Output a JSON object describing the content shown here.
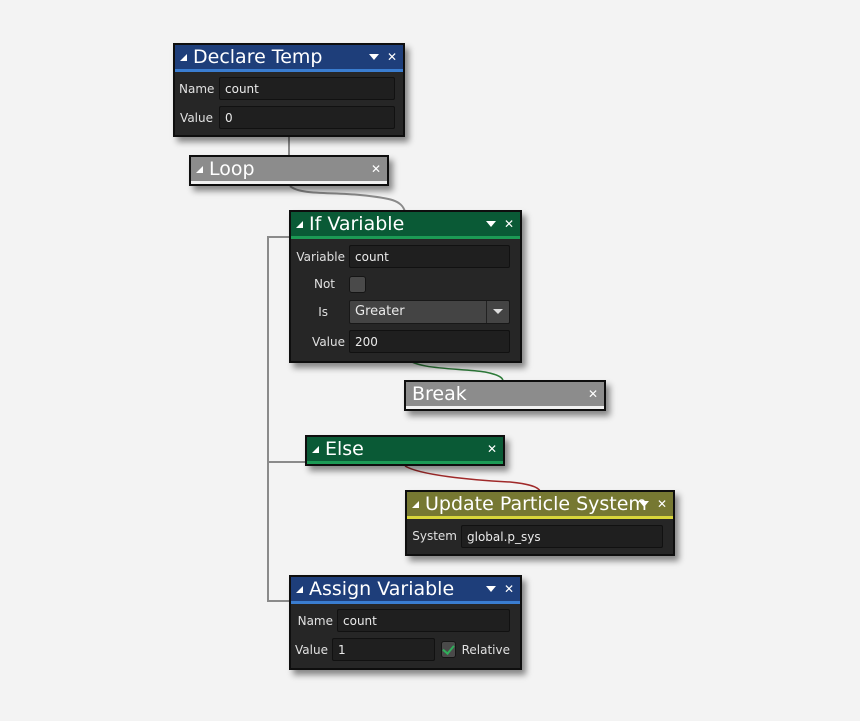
{
  "colors": {
    "canvas_bg": "#f3f3f3",
    "node_body": "#262626",
    "blue_header": "#1e3e7a",
    "blue_accent": "#3a7dd0",
    "green_header": "#0a5a36",
    "green_accent": "#1c9a55",
    "gray_header": "#8c8c8c",
    "olive_header": "#767832",
    "olive_accent": "#d8d63a",
    "wire_gray": "#888888",
    "wire_green": "#2e7d3a",
    "wire_red": "#a02a2a"
  },
  "nodes": {
    "declare_temp": {
      "title": "Declare Temp",
      "fields": [
        {
          "label": "Name",
          "value": "count"
        },
        {
          "label": "Value",
          "value": "0"
        }
      ]
    },
    "loop": {
      "title": "Loop"
    },
    "if_variable": {
      "title": "If Variable",
      "variable_label": "Variable",
      "variable_value": "count",
      "not_label": "Not",
      "not_checked": false,
      "is_label": "Is",
      "is_value": "Greater",
      "value_label": "Value",
      "value_value": "200"
    },
    "break": {
      "title": "Break"
    },
    "else": {
      "title": "Else"
    },
    "update_particle_system": {
      "title": "Update Particle System",
      "system_label": "System",
      "system_value": "global.p_sys"
    },
    "assign_variable": {
      "title": "Assign Variable",
      "name_label": "Name",
      "name_value": "count",
      "value_label": "Value",
      "value_value": "1",
      "relative_label": "Relative",
      "relative_checked": true
    }
  },
  "icons": {
    "collapse": "collapse-triangle-icon",
    "dropdown": "dropdown-arrow-icon",
    "close": "close-icon",
    "check": "check-icon"
  }
}
